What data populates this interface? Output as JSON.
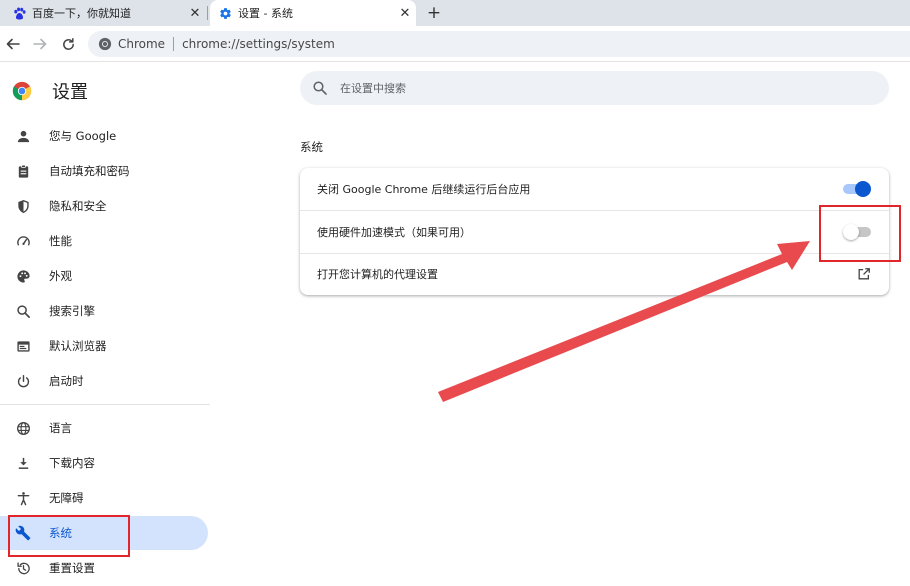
{
  "tabs": [
    {
      "title": "百度一下，你就知道",
      "favicon": "baidu-paw-icon",
      "close": "✕"
    },
    {
      "title": "设置 - 系统",
      "favicon": "settings-gear-icon",
      "close": "✕"
    }
  ],
  "new_tab_label": "+",
  "address_bar": {
    "origin_label": "Chrome",
    "url": "chrome://settings/system"
  },
  "sidebar": {
    "title": "设置",
    "items": [
      {
        "label": "您与 Google",
        "icon": "person-icon"
      },
      {
        "label": "自动填充和密码",
        "icon": "clipboard-icon"
      },
      {
        "label": "隐私和安全",
        "icon": "shield-icon"
      },
      {
        "label": "性能",
        "icon": "speedometer-icon"
      },
      {
        "label": "外观",
        "icon": "palette-icon"
      },
      {
        "label": "搜索引擎",
        "icon": "search-icon"
      },
      {
        "label": "默认浏览器",
        "icon": "browser-window-icon"
      },
      {
        "label": "启动时",
        "icon": "power-icon"
      },
      {
        "label": "语言",
        "icon": "globe-icon"
      },
      {
        "label": "下载内容",
        "icon": "download-icon"
      },
      {
        "label": "无障碍",
        "icon": "accessibility-icon"
      },
      {
        "label": "系统",
        "icon": "wrench-icon",
        "active": true
      },
      {
        "label": "重置设置",
        "icon": "reset-history-icon"
      }
    ]
  },
  "search": {
    "placeholder": "在设置中搜索"
  },
  "section": {
    "title": "系统",
    "rows": [
      {
        "label": "关闭 Google Chrome 后继续运行后台应用",
        "control": "toggle",
        "enabled": true
      },
      {
        "label": "使用硬件加速模式（如果可用）",
        "control": "toggle",
        "enabled": false
      },
      {
        "label": "打开您计算机的代理设置",
        "control": "external-link"
      }
    ]
  },
  "colors": {
    "accent": "#0b57d0",
    "annotation": "#e1262b",
    "tabstrip": "#dee3ea",
    "active_nav": "#d3e3fd"
  }
}
